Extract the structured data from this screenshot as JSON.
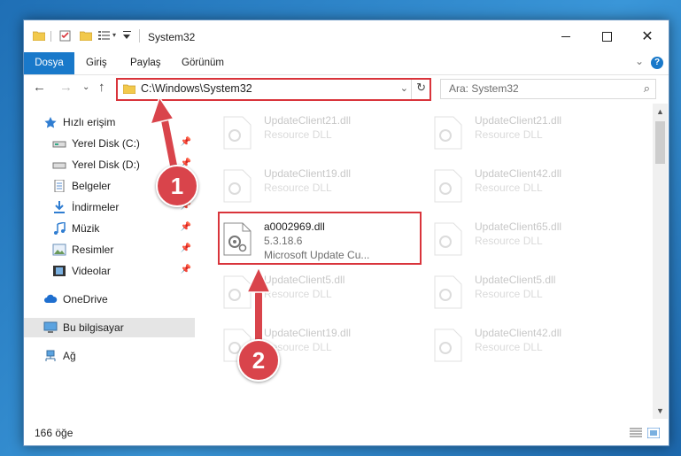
{
  "window": {
    "title": "System32"
  },
  "ribbon": {
    "tabs": [
      "Dosya",
      "Giriş",
      "Paylaş",
      "Görünüm"
    ],
    "help_label": "?"
  },
  "navigation": {
    "address": "C:\\Windows\\System32",
    "search_placeholder": "Ara: System32"
  },
  "sidebar": {
    "items": [
      {
        "label": "Hızlı erişim",
        "icon": "star-icon",
        "pinned": false
      },
      {
        "label": "Yerel Disk (C:)",
        "icon": "drive-icon",
        "pinned": true
      },
      {
        "label": "Yerel Disk (D:)",
        "icon": "drive-icon",
        "pinned": true
      },
      {
        "label": "Belgeler",
        "icon": "documents-icon",
        "pinned": true
      },
      {
        "label": "İndirmeler",
        "icon": "downloads-icon",
        "pinned": true
      },
      {
        "label": "Müzik",
        "icon": "music-icon",
        "pinned": true
      },
      {
        "label": "Resimler",
        "icon": "pictures-icon",
        "pinned": true
      },
      {
        "label": "Videolar",
        "icon": "videos-icon",
        "pinned": true
      },
      {
        "label": "OneDrive",
        "icon": "cloud-icon",
        "pinned": false
      },
      {
        "label": "Bu bilgisayar",
        "icon": "computer-icon",
        "pinned": false,
        "selected": true
      },
      {
        "label": "Ağ",
        "icon": "network-icon",
        "pinned": false
      }
    ]
  },
  "files": {
    "left": [
      {
        "name": "UpdateClient21.dll",
        "desc": "Resource DLL"
      },
      {
        "name": "UpdateClient19.dll",
        "desc": "Resource DLL"
      },
      {
        "name": "a0002969.dll",
        "version": "5.3.18.6",
        "desc": "Microsoft Update Cu...",
        "highlighted": true
      },
      {
        "name": "UpdateClient5.dll",
        "desc": "Resource DLL"
      },
      {
        "name": "UpdateClient19.dll",
        "desc": "Resource DLL"
      }
    ],
    "right": [
      {
        "name": "UpdateClient21.dll",
        "desc": "Resource DLL"
      },
      {
        "name": "UpdateClient42.dll",
        "desc": "Resource DLL"
      },
      {
        "name": "UpdateClient65.dll",
        "desc": "Resource DLL"
      },
      {
        "name": "UpdateClient5.dll",
        "desc": "Resource DLL"
      },
      {
        "name": "UpdateClient42.dll",
        "desc": "Resource DLL"
      }
    ]
  },
  "status": {
    "item_count": "166 öğe"
  },
  "callouts": [
    "1",
    "2"
  ],
  "colors": {
    "accent": "#1979ca",
    "callout": "#d9444b",
    "highlight_border": "#d9343b"
  }
}
